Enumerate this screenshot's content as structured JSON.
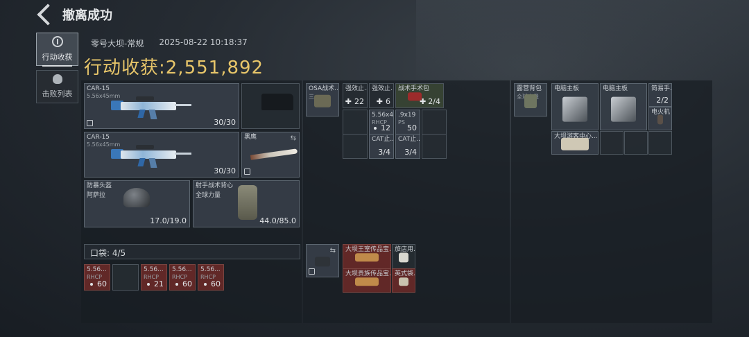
{
  "header": {
    "title": "撤离成功"
  },
  "side": {
    "harvest_label": "行动收获",
    "kills_label": "击败列表"
  },
  "meta": {
    "map": "零号大坝-常规",
    "datetime": "2025-08-22 10:18:37"
  },
  "harvest": {
    "label": "行动收获:",
    "value": "2,551,892"
  },
  "gear": {
    "gun1": {
      "name": "CAR-15",
      "caliber": "5.56x45mm",
      "ammo": "30/30"
    },
    "gun2": {
      "name": "CAR-15",
      "caliber": "5.56x45mm",
      "ammo": "30/30"
    },
    "knife": {
      "name": "黑鹰"
    },
    "helmet": {
      "name": "防暴头盔",
      "sub": "阿萨拉",
      "durability": "17.0/19.0"
    },
    "vest": {
      "name": "射手战术背心",
      "sub": "全球力量",
      "durability": "44.0/85.0"
    }
  },
  "pocket": {
    "label": "口袋:",
    "count": "4/5",
    "items": [
      {
        "name": "5.56...",
        "sub": "RHCP",
        "count": "60"
      },
      {
        "name": "",
        "sub": "",
        "count": ""
      },
      {
        "name": "5.56...",
        "sub": "RHCP",
        "count": "21"
      },
      {
        "name": "5.56...",
        "sub": "RHCP",
        "count": "60"
      },
      {
        "name": "5.56...",
        "sub": "RHCP",
        "count": "60"
      }
    ]
  },
  "chest": {
    "rig": {
      "name": "OSA战术...",
      "sub": "三..."
    },
    "items": [
      {
        "name": "强效止...",
        "count": "22"
      },
      {
        "name": "强效止...",
        "count": "6"
      },
      {
        "name": "战术手术包",
        "count": "2/4"
      },
      {
        "name": "5.56x4...",
        "sub": "RHCP",
        "count": "12"
      },
      {
        "name": ".9x19",
        "sub": "PS",
        "count": "50"
      },
      {
        "name": "CAT止...",
        "count": "3/4"
      },
      {
        "name": "CAT止...",
        "count": "3/4"
      }
    ]
  },
  "bag": {
    "container": {
      "name": "露营背包",
      "sub": "全球力量"
    },
    "items": [
      {
        "name": "电脑主板"
      },
      {
        "name": "电脑主板"
      },
      {
        "name": "简易手...",
        "count": "2/2"
      },
      {
        "name": "电火机"
      },
      {
        "name": "大坝游客中心..."
      }
    ]
  },
  "safe": {
    "items": [
      {
        "name": "大坝王室传品宝..."
      },
      {
        "name": "旅店用..."
      },
      {
        "name": "大坝贵族传品宝..."
      },
      {
        "name": "英式袋..."
      }
    ]
  }
}
